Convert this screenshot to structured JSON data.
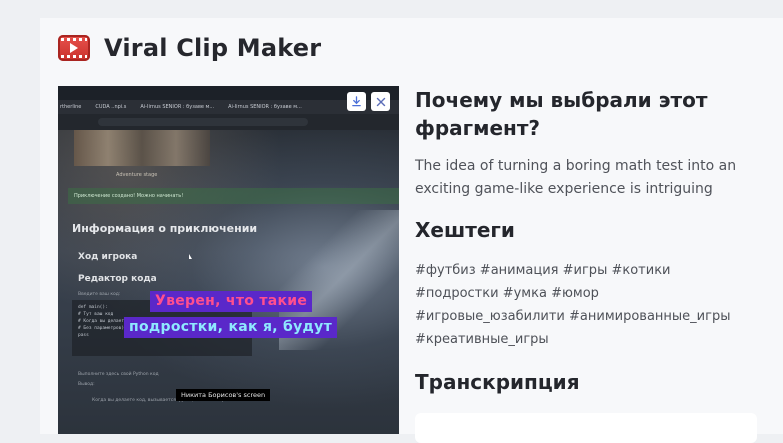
{
  "header": {
    "title": "Viral Clip Maker",
    "icon": "film-clip-icon"
  },
  "video": {
    "browser_tabs": [
      "rtherline",
      "CUDA ..npi.s",
      "Ai-Iirnus SENIOR : бузаве м...",
      "Ai-Iirnus SENIOR : бузаве м..."
    ],
    "thumb_caption": "Adventure stage",
    "banner_text": "Приключение создано! Можно начинать!",
    "info_title": "Информация о приключении",
    "menu_player": "Ход игрока",
    "menu_editor": "Редактор кода",
    "small_line": "Введите ваш код:",
    "code_lines": [
      "def main():",
      "  # Тут ваш код",
      "  # Когда вы делаете проверку кода (вторая кнопка)",
      "  # Без параметров)",
      "  pass"
    ],
    "bottom_line": "Выполните здесь свой Python код",
    "bottom_line2": "Вывод:",
    "bottom_line3": "Когда вы делаете код, вызывается функция main в игре",
    "subtitle_line1": "Уверен, что такие",
    "subtitle_line2": "подростки, как я, будут",
    "screen_label": "Никита Борисов's screen",
    "download_icon": "download-icon",
    "close_icon": "close-icon"
  },
  "why": {
    "title": "Почему мы выбрали этот фрагмент?",
    "text": "The idea of turning a boring math test into an exciting game-like experience is intriguing"
  },
  "hashtags": {
    "title": "Хештеги",
    "tags": [
      "#футбиз",
      "#анимация",
      "#игры",
      "#котики",
      "#подростки",
      "#умка",
      "#юмор",
      "#игровые_юзабилити",
      "#анимированные_игры",
      "#креативные_игры"
    ]
  },
  "transcript": {
    "title": "Транскрипция"
  }
}
